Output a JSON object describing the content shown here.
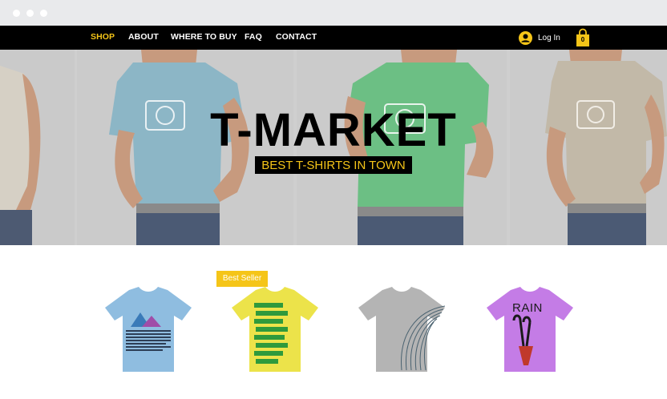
{
  "nav": {
    "items": [
      {
        "label": "SHOP",
        "active": true
      },
      {
        "label": "ABOUT",
        "active": false
      },
      {
        "label": "WHERE TO BUY",
        "active": false
      },
      {
        "label": "FAQ",
        "active": false
      },
      {
        "label": "CONTACT",
        "active": false
      }
    ],
    "login_label": "Log In",
    "cart_count": "0"
  },
  "hero": {
    "title": "T-MARKET",
    "subtitle": "BEST T-SHIRTS IN TOWN",
    "shirt_colors": [
      "#d5cfc4",
      "#8cb6c6",
      "#6cbf84",
      "#c2b9a8"
    ]
  },
  "products": {
    "badge": "Best Seller",
    "items": [
      {
        "name": "mountain-tshirt",
        "color": "#8fbde0"
      },
      {
        "name": "lorem-ipsum-tshirt",
        "color": "#ece34a",
        "print_text": "Lorem ipsum dolor sit amet"
      },
      {
        "name": "swirl-tshirt",
        "color": "#b4b4b4"
      },
      {
        "name": "rain-tshirt",
        "color": "#c47ce6",
        "print_text": "RAIN"
      }
    ]
  },
  "colors": {
    "accent": "#f5c518",
    "nav_bg": "#000000",
    "hero_bg": "#cbcbcb"
  }
}
